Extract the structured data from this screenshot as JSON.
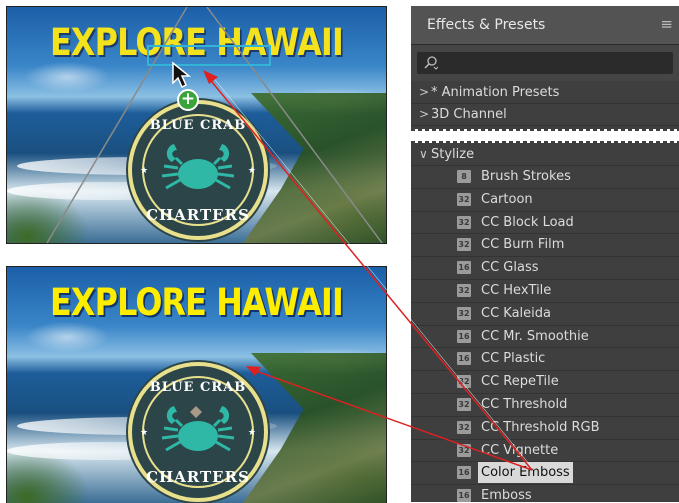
{
  "comp_top": {
    "headline": "EXPLORE HAWAII",
    "logo_top_text": "BLUE CRAB",
    "logo_bottom_text": "CHARTERS",
    "drop_badge": "+"
  },
  "comp_bottom": {
    "headline": "EXPLORE HAWAII",
    "logo_top_text": "BLUE CRAB",
    "logo_bottom_text": "CHARTERS"
  },
  "panel": {
    "title": "Effects & Presets",
    "menu_icon": "≡",
    "search_placeholder": "",
    "groups": [
      {
        "twisty": ">",
        "label": "* Animation Presets"
      },
      {
        "twisty": ">",
        "label": "3D Channel"
      }
    ],
    "stylize": {
      "twisty": "∨",
      "label": "Stylize"
    },
    "effects": [
      {
        "bits": "8",
        "label": "Brush Strokes"
      },
      {
        "bits": "32",
        "label": "Cartoon"
      },
      {
        "bits": "32",
        "label": "CC Block Load"
      },
      {
        "bits": "32",
        "label": "CC Burn Film"
      },
      {
        "bits": "16",
        "label": "CC Glass"
      },
      {
        "bits": "32",
        "label": "CC HexTile"
      },
      {
        "bits": "32",
        "label": "CC Kaleida"
      },
      {
        "bits": "16",
        "label": "CC Mr. Smoothie"
      },
      {
        "bits": "16",
        "label": "CC Plastic"
      },
      {
        "bits": "32",
        "label": "CC RepeTile"
      },
      {
        "bits": "32",
        "label": "CC Threshold"
      },
      {
        "bits": "32",
        "label": "CC Threshold RGB"
      },
      {
        "bits": "32",
        "label": "CC Vignette"
      },
      {
        "bits": "16",
        "label": "Color Emboss",
        "selected": true
      },
      {
        "bits": "16",
        "label": "Emboss"
      }
    ]
  },
  "colors": {
    "drag_arrow": "#e02020",
    "bounding_box": "#33b4d6",
    "headline": "#f3e21c",
    "logo_fill": "#2c4548",
    "crab": "#2fb8a6"
  }
}
